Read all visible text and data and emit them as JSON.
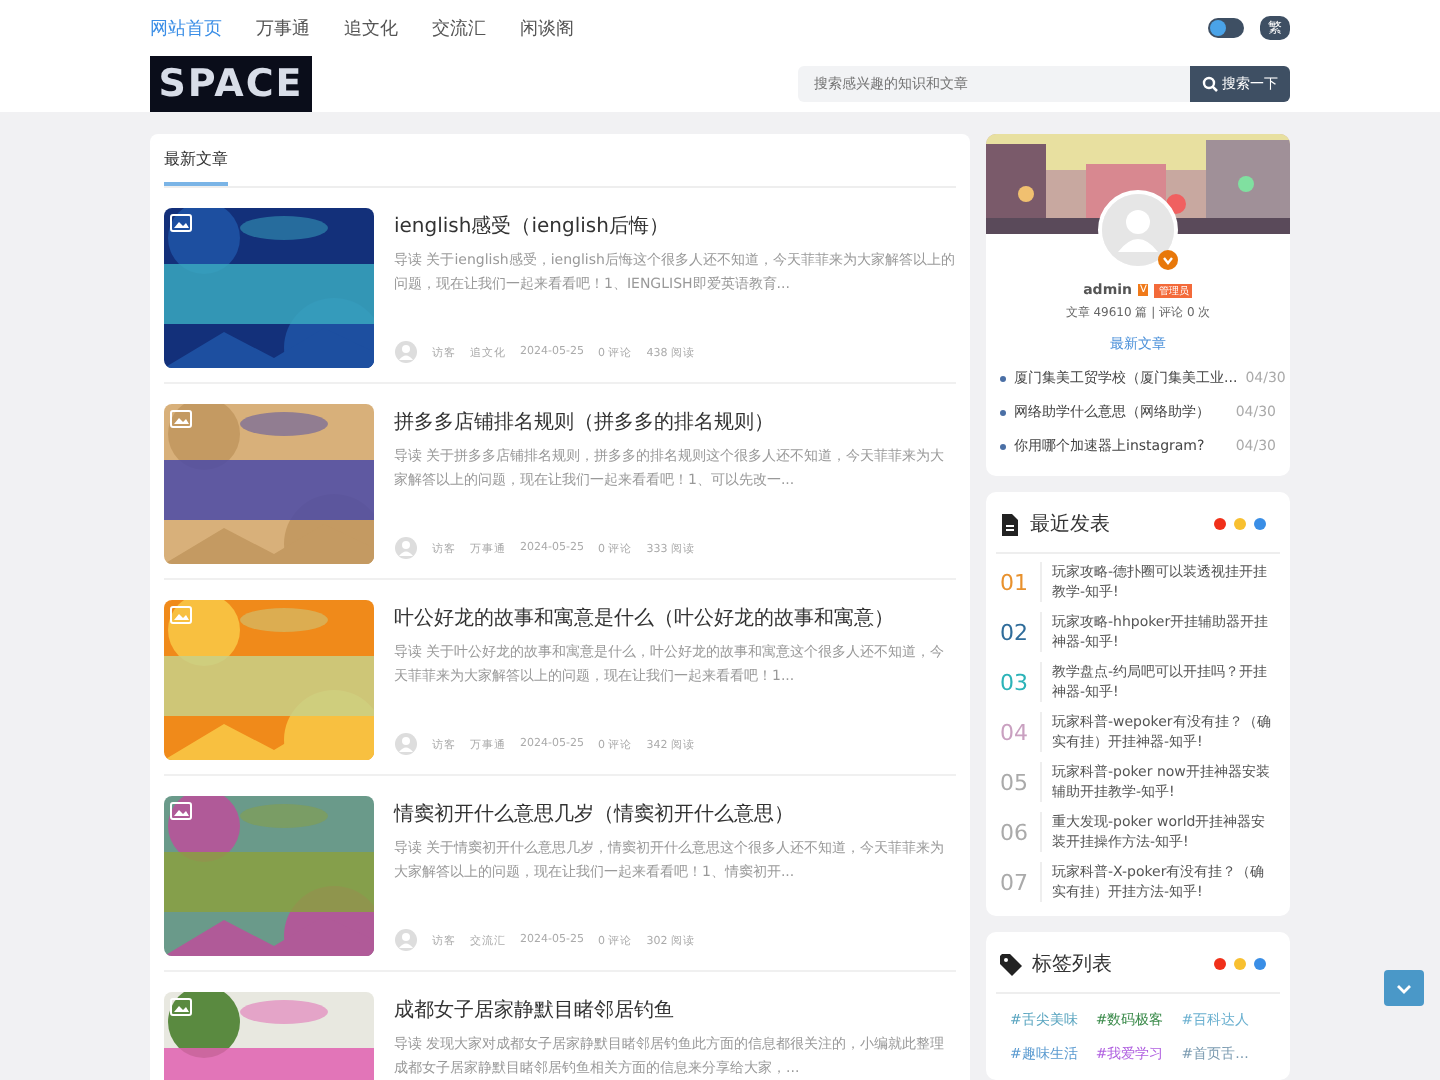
{
  "nav": [
    {
      "label": "网站首页",
      "selected": true
    },
    {
      "label": "万事通",
      "selected": false
    },
    {
      "label": "追文化",
      "selected": false
    },
    {
      "label": "交流汇",
      "selected": false
    },
    {
      "label": "闲谈阁",
      "selected": false
    }
  ],
  "theme_toggle": {
    "on": false
  },
  "lang_button": "繁",
  "logo": "SPACE",
  "search": {
    "placeholder": "搜索感兴趣的知识和文章",
    "button": "搜索一下"
  },
  "tabs": [
    {
      "label": "最新文章",
      "selected": true
    }
  ],
  "articles": [
    {
      "title": "ienglish感受（ienglish后悔）",
      "summary": "导读 关于ienglish感受，ienglish后悔这个很多人还不知道，今天菲菲来为大家解答以上的问题，现在让我们一起来看看吧！1、IENGLISH即爱英语教育...",
      "author": "访客",
      "category": "追文化",
      "date": "2024-05-25",
      "comments": "0 评论",
      "views": "438 阅读"
    },
    {
      "title": "拼多多店铺排名规则（拼多多的排名规则）",
      "summary": "导读 关于拼多多店铺排名规则，拼多多的排名规则这个很多人还不知道，今天菲菲来为大家解答以上的问题，现在让我们一起来看看吧！1、可以先改一...",
      "author": "访客",
      "category": "万事通",
      "date": "2024-05-25",
      "comments": "0 评论",
      "views": "333 阅读"
    },
    {
      "title": "叶公好龙的故事和寓意是什么（叶公好龙的故事和寓意）",
      "summary": "导读 关于叶公好龙的故事和寓意是什么，叶公好龙的故事和寓意这个很多人还不知道，今天菲菲来为大家解答以上的问题，现在让我们一起来看看吧！1...",
      "author": "访客",
      "category": "万事通",
      "date": "2024-05-25",
      "comments": "0 评论",
      "views": "342 阅读"
    },
    {
      "title": "情窦初开什么意思几岁（情窦初开什么意思）",
      "summary": "导读 关于情窦初开什么意思几岁，情窦初开什么意思这个很多人还不知道，今天菲菲来为大家解答以上的问题，现在让我们一起来看看吧！1、情窦初开...",
      "author": "访客",
      "category": "交流汇",
      "date": "2024-05-25",
      "comments": "0 评论",
      "views": "302 阅读"
    },
    {
      "title": "成都女子居家静默目睹邻居钓鱼",
      "summary": "导读 发现大家对成都女子居家静默目睹邻居钓鱼此方面的信息都很关注的，小编就此整理成都女子居家静默目睹邻居钓鱼相关方面的信息来分享给大家，..."
    }
  ],
  "profile": {
    "name": "admin",
    "vip": "V",
    "role": "管理员",
    "stats": "文章 49610 篇 | 评论 0 次",
    "section": "最新文章",
    "posts": [
      {
        "title": "厦门集美工贸学校（厦门集美工业...",
        "date": "04/30"
      },
      {
        "title": "网络助学什么意思（网络助学）",
        "date": "04/30"
      },
      {
        "title": "你用哪个加速器上instagram?",
        "date": "04/30"
      }
    ]
  },
  "recent": {
    "title": "最近发表",
    "items": [
      {
        "num": "01",
        "color": "#e8912d",
        "text": "玩家攻略-德扑圈可以装透视挂开挂教学-知乎!"
      },
      {
        "num": "02",
        "color": "#2f6c9a",
        "text": "玩家攻略-hhpoker开挂辅助器开挂神器-知乎!"
      },
      {
        "num": "03",
        "color": "#2bb3b8",
        "text": "教学盘点-约局吧可以开挂吗？开挂神器-知乎!"
      },
      {
        "num": "04",
        "color": "#c9a0c0",
        "text": "玩家科普-wepoker有没有挂？（确实有挂）开挂神器-知乎!"
      },
      {
        "num": "05",
        "color": "#aaaaaa",
        "text": "玩家科普-poker now开挂神器安装辅助开挂教学-知乎!"
      },
      {
        "num": "06",
        "color": "#aaaaaa",
        "text": "重大发现-poker world开挂神器安装开挂操作方法-知乎!"
      },
      {
        "num": "07",
        "color": "#aaaaaa",
        "text": "玩家科普-X-poker有没有挂？（确实有挂）开挂方法-知乎!"
      }
    ]
  },
  "tags": {
    "title": "标签列表",
    "items": [
      {
        "label": "#舌尖美味",
        "color": "#5aa5c0"
      },
      {
        "label": "#数码极客",
        "color": "#3a8a4a"
      },
      {
        "label": "#百科达人",
        "color": "#6ab0d0"
      },
      {
        "label": "#趣味生活",
        "color": "#5a9ad0"
      },
      {
        "label": "#我爱学习",
        "color": "#b060e0"
      },
      {
        "label": "#首页舌...",
        "color": "#7a9ab0"
      }
    ]
  }
}
